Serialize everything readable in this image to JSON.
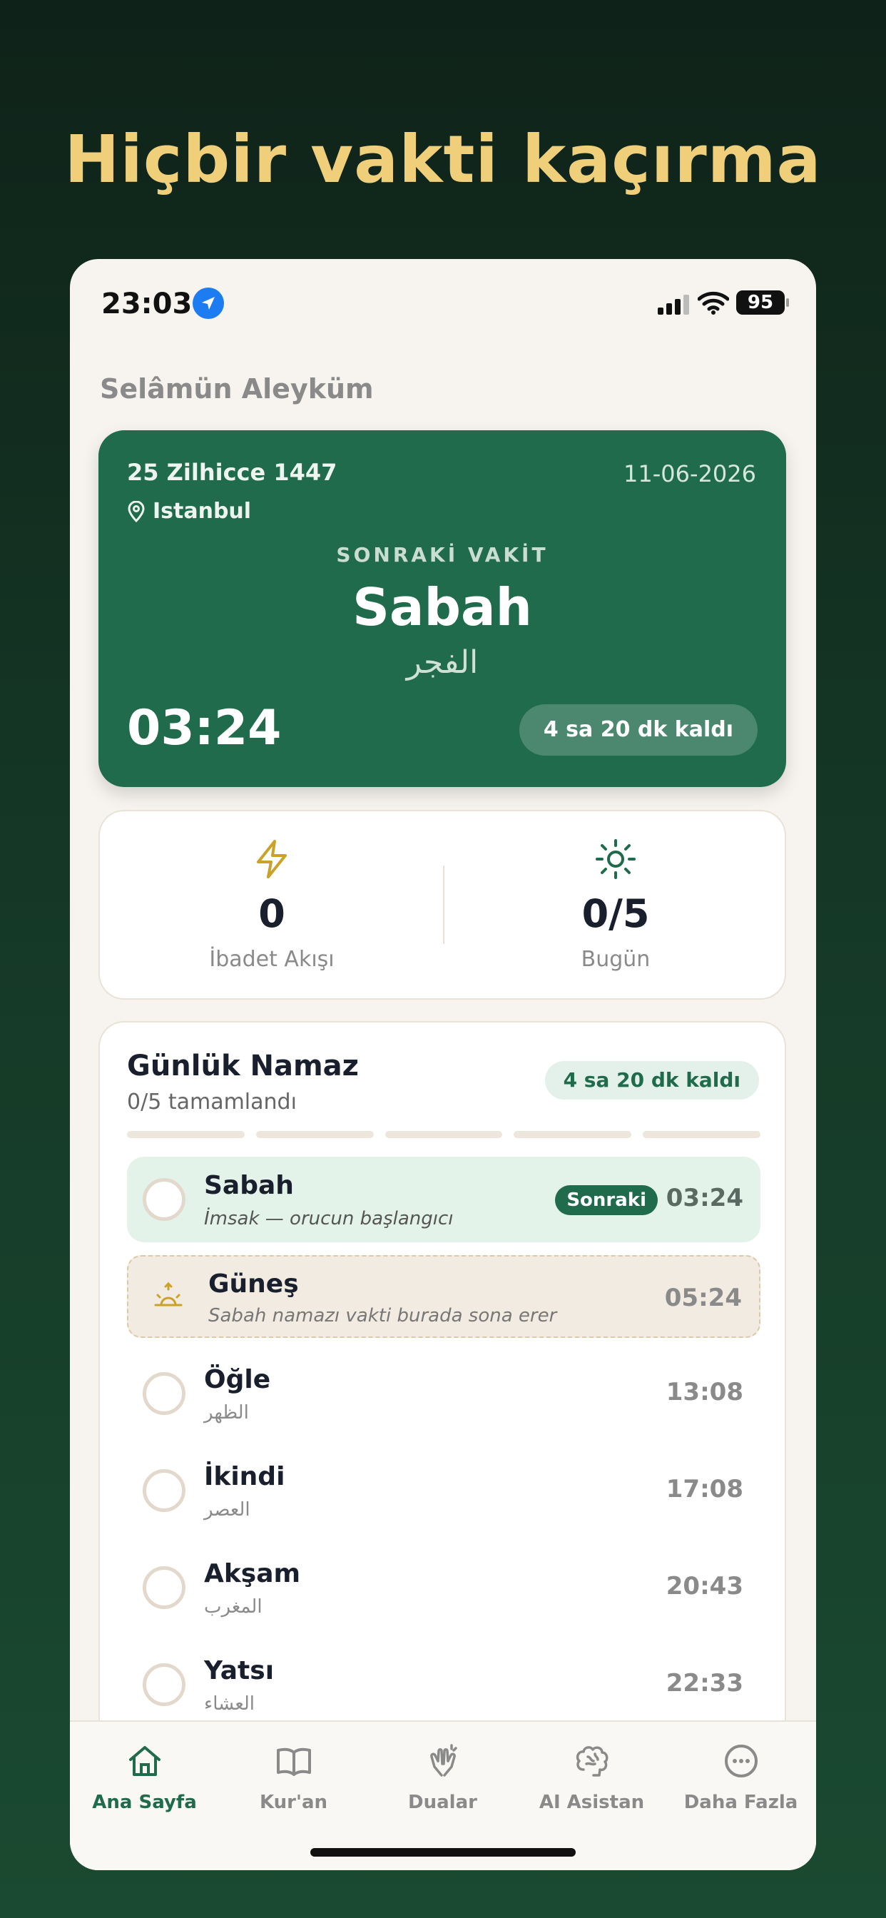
{
  "headline": "Hiçbir vakti kaçırma",
  "status_bar": {
    "time": "23:03",
    "battery": "95"
  },
  "greeting": "Selâmün Aleyküm",
  "next_prayer": {
    "hijri_date": "25 Zilhicce 1447",
    "gregorian_date": "11-06-2026",
    "city": "Istanbul",
    "label": "SONRAKİ VAKİT",
    "name": "Sabah",
    "arabic": "الفجر",
    "time": "03:24",
    "remaining": "4 sa 20 dk kaldı"
  },
  "stats": {
    "streak": {
      "value": "0",
      "label": "İbadet Akışı"
    },
    "today": {
      "value": "0/5",
      "label": "Bugün"
    }
  },
  "daily": {
    "title": "Günlük Namaz",
    "subtitle": "0/5 tamamlandı",
    "remaining": "4 sa 20 dk kaldı",
    "progress_completed": 0,
    "progress_total": 5,
    "prayers": [
      {
        "name": "Sabah",
        "sub": "İmsak — orucun başlangıcı",
        "time": "03:24",
        "tag": "Sonraki"
      },
      {
        "name": "Güneş",
        "sub": "Sabah namazı vakti burada sona erer",
        "time": "05:24"
      },
      {
        "name": "Öğle",
        "sub": "الظهر",
        "time": "13:08"
      },
      {
        "name": "İkindi",
        "sub": "العصر",
        "time": "17:08"
      },
      {
        "name": "Akşam",
        "sub": "المغرب",
        "time": "20:43"
      },
      {
        "name": "Yatsı",
        "sub": "العشاء",
        "time": "22:33"
      }
    ]
  },
  "tabs": [
    {
      "label": "Ana Sayfa",
      "icon": "home-icon",
      "active": true
    },
    {
      "label": "Kur'an",
      "icon": "book-icon"
    },
    {
      "label": "Dualar",
      "icon": "praying-hands-icon"
    },
    {
      "label": "AI Asistan",
      "icon": "brain-icon"
    },
    {
      "label": "Daha Fazla",
      "icon": "more-icon"
    }
  ],
  "colors": {
    "accent": "#1f6b4b",
    "headline": "#f0cf7a",
    "gold": "#c9a227"
  }
}
